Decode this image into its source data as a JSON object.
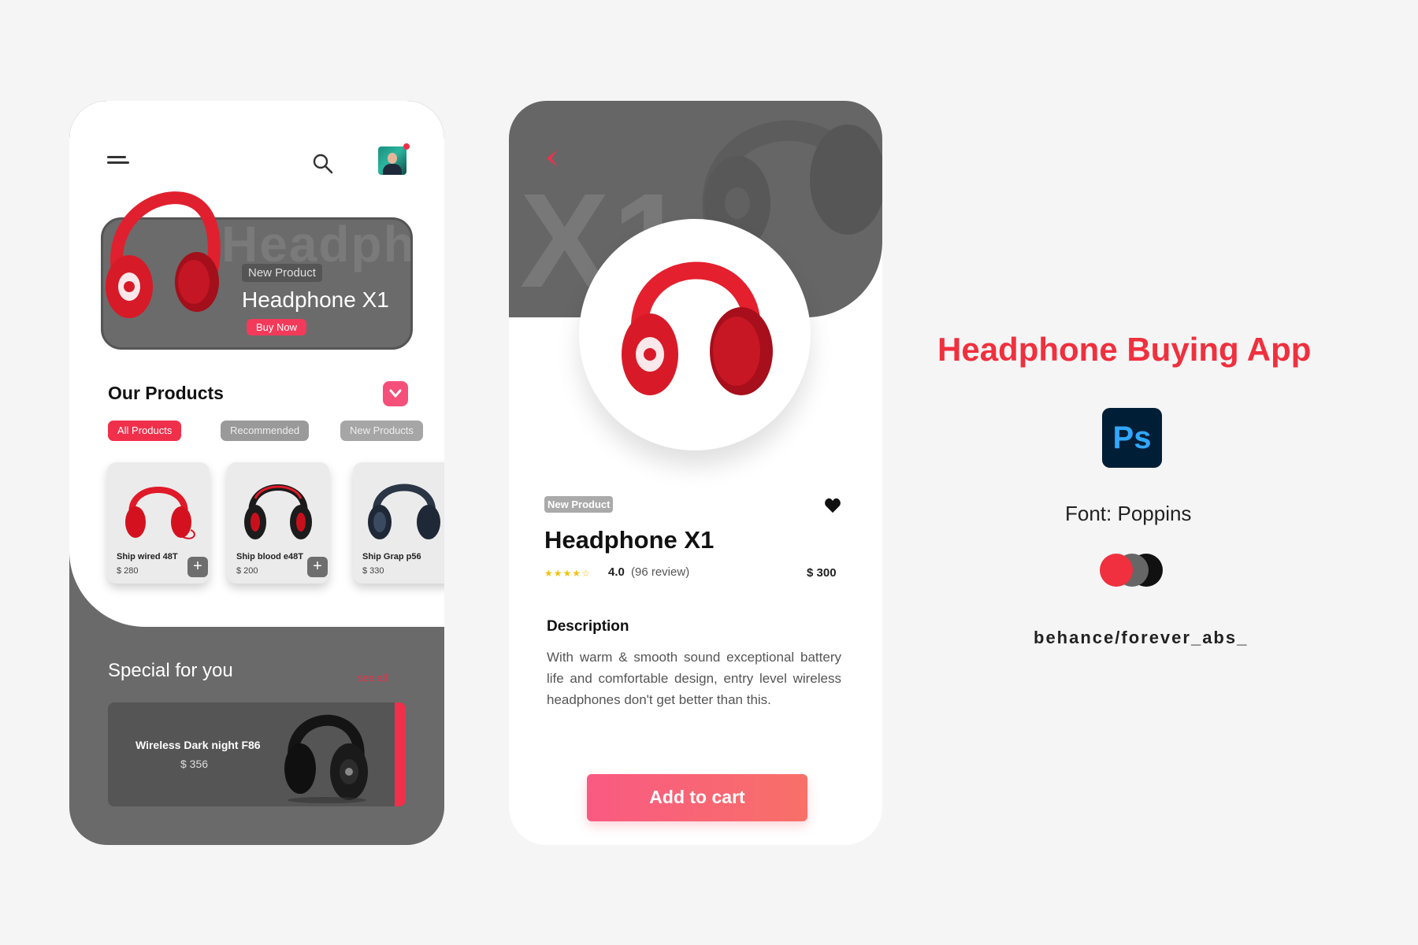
{
  "colors": {
    "accent": "#f0304a",
    "dark_gray": "#6a6a6a",
    "black": "#111111",
    "background": "#f5f5f5"
  },
  "screen1": {
    "header": {
      "menu_icon": "menu-icon",
      "search_icon": "search-icon",
      "avatar": "user-avatar"
    },
    "hero": {
      "watermark": "Headph",
      "badge": "New Product",
      "title": "Headphone X1",
      "button_label": "Buy Now"
    },
    "products_section": {
      "title": "Our Products",
      "dropdown_icon": "chevron-down-icon",
      "filters": [
        "All Products",
        "Recommended",
        "New Products"
      ],
      "active_filter": "All Products",
      "items": [
        {
          "name": "Ship wired 48T",
          "price": "$ 280",
          "color": "red"
        },
        {
          "name": "Ship blood e48T",
          "price": "$ 200",
          "color": "black-red"
        },
        {
          "name": "Ship Grap p56",
          "price": "$ 330",
          "color": "navy"
        }
      ],
      "add_icon": "plus-icon",
      "add_label": "+"
    },
    "special": {
      "title": "Special for you",
      "see_all": "see all",
      "product_name": "Wireless Dark night F86",
      "product_price": "$ 356"
    }
  },
  "screen2": {
    "watermark": "X1",
    "back_icon": "chevron-left-icon",
    "badge": "New Product",
    "favorite_icon": "heart-icon",
    "title": "Headphone X1",
    "stars": "★★★★☆",
    "rating": "4.0",
    "reviews": "(96 review)",
    "price": "$ 300",
    "description_heading": "Description",
    "description": "With warm & smooth sound exceptional battery life and comfortable design, entry level wireless headphones don't get  better than this.",
    "cart_button": "Add to cart"
  },
  "info_panel": {
    "title": "Headphone Buying App",
    "tool": "Ps",
    "font_label": "Font: Poppins",
    "palette": [
      "#f0303e",
      "#666666",
      "#111111"
    ],
    "handle": "behance/forever_abs_"
  }
}
